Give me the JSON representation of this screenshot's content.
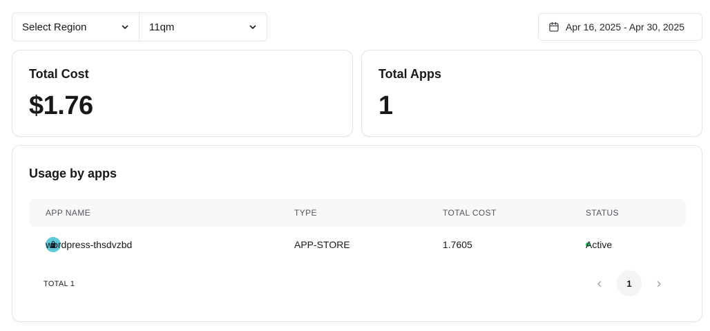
{
  "filters": {
    "region": {
      "selected": "Select Region"
    },
    "cluster": {
      "selected": "11qm"
    }
  },
  "date_range": {
    "label": "Apr 16, 2025 - Apr 30, 2025"
  },
  "stats": {
    "total_cost": {
      "label": "Total Cost",
      "value": "$1.76"
    },
    "total_apps": {
      "label": "Total Apps",
      "value": "1"
    }
  },
  "usage": {
    "title": "Usage by apps",
    "columns": [
      "APP NAME",
      "TYPE",
      "TOTAL COST",
      "STATUS"
    ],
    "rows": [
      {
        "app_name": "wordpress-thsdvzbd",
        "type": "APP-STORE",
        "total_cost": "1.7605",
        "status": "Active"
      }
    ],
    "total_label": "TOTAL 1",
    "pagination": {
      "current_page": "1"
    }
  },
  "icons": {
    "chevron": "chevron-down-icon",
    "calendar": "calendar-icon",
    "app": "shopping-bag-icon",
    "prev": "chevron-left-icon",
    "next": "chevron-right-icon"
  },
  "colors": {
    "active_status": "#22c55e",
    "app_icon_bg": "#5ec9d6",
    "border": "#e4e4e7"
  }
}
